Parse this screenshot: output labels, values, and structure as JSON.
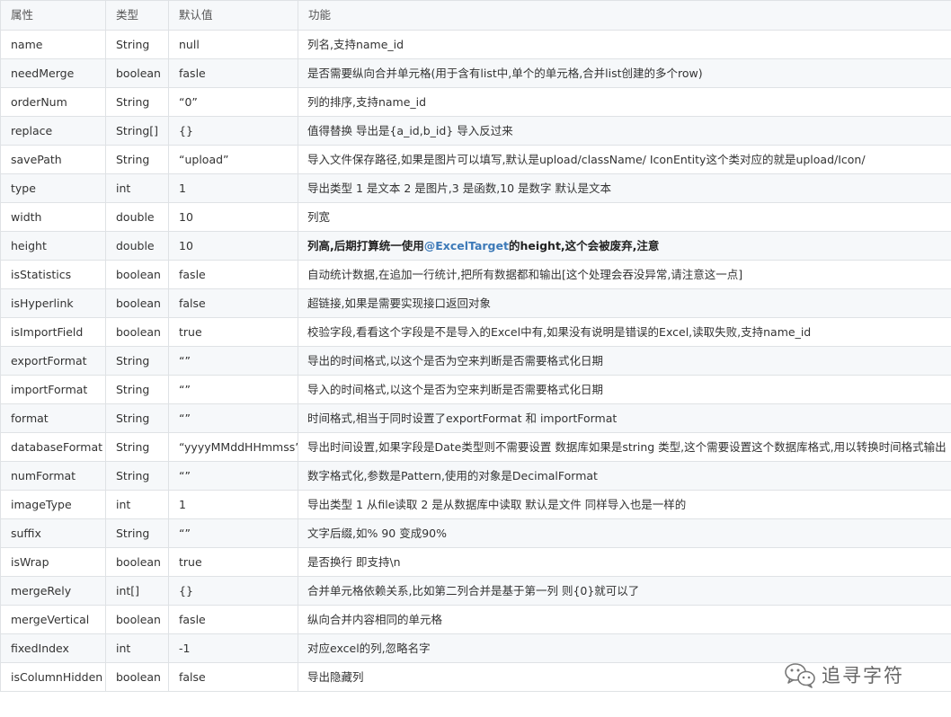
{
  "table": {
    "headers": [
      "属性",
      "类型",
      "默认值",
      "功能"
    ],
    "rows": [
      {
        "name": "name",
        "type": "String",
        "default": "null",
        "desc": "列名,支持name_id"
      },
      {
        "name": "needMerge",
        "type": "boolean",
        "default": "fasle",
        "desc": "是否需要纵向合并单元格(用于含有list中,单个的单元格,合并list创建的多个row)"
      },
      {
        "name": "orderNum",
        "type": "String",
        "default": "“0”",
        "desc": "列的排序,支持name_id"
      },
      {
        "name": "replace",
        "type": "String[]",
        "default": "{}",
        "desc": "值得替换 导出是{a_id,b_id} 导入反过来"
      },
      {
        "name": "savePath",
        "type": "String",
        "default": "“upload”",
        "desc": "导入文件保存路径,如果是图片可以填写,默认是upload/className/ IconEntity这个类对应的就是upload/Icon/"
      },
      {
        "name": "type",
        "type": "int",
        "default": "1",
        "desc": "导出类型 1 是文本 2 是图片,3 是函数,10 是数字 默认是文本"
      },
      {
        "name": "width",
        "type": "double",
        "default": "10",
        "desc": "列宽"
      },
      {
        "name": "height",
        "type": "double",
        "default": "10",
        "desc_pre": "列高,后期打算统一使用",
        "desc_link": "@ExcelTarget",
        "desc_post": "的height,这个会被废弃,注意"
      },
      {
        "name": "isStatistics",
        "type": "boolean",
        "default": "fasle",
        "desc": "自动统计数据,在追加一行统计,把所有数据都和输出[这个处理会吞没异常,请注意这一点]"
      },
      {
        "name": "isHyperlink",
        "type": "boolean",
        "default": "false",
        "desc": "超链接,如果是需要实现接口返回对象"
      },
      {
        "name": "isImportField",
        "type": "boolean",
        "default": "true",
        "desc": "校验字段,看看这个字段是不是导入的Excel中有,如果没有说明是错误的Excel,读取失败,支持name_id"
      },
      {
        "name": "exportFormat",
        "type": "String",
        "default": "“”",
        "desc": "导出的时间格式,以这个是否为空来判断是否需要格式化日期"
      },
      {
        "name": "importFormat",
        "type": "String",
        "default": "“”",
        "desc": "导入的时间格式,以这个是否为空来判断是否需要格式化日期"
      },
      {
        "name": "format",
        "type": "String",
        "default": "“”",
        "desc": "时间格式,相当于同时设置了exportFormat 和 importFormat"
      },
      {
        "name": "databaseFormat",
        "type": "String",
        "default": "“yyyyMMddHHmmss”",
        "desc": "导出时间设置,如果字段是Date类型则不需要设置 数据库如果是string 类型,这个需要设置这个数据库格式,用以转换时间格式输出"
      },
      {
        "name": "numFormat",
        "type": "String",
        "default": "“”",
        "desc": "数字格式化,参数是Pattern,使用的对象是DecimalFormat"
      },
      {
        "name": "imageType",
        "type": "int",
        "default": "1",
        "desc": "导出类型 1 从file读取 2 是从数据库中读取 默认是文件 同样导入也是一样的"
      },
      {
        "name": "suffix",
        "type": "String",
        "default": "“”",
        "desc": "文字后缀,如% 90 变成90%"
      },
      {
        "name": "isWrap",
        "type": "boolean",
        "default": "true",
        "desc": "是否换行 即支持\\n"
      },
      {
        "name": "mergeRely",
        "type": "int[]",
        "default": "{}",
        "desc": "合并单元格依赖关系,比如第二列合并是基于第一列 则{0}就可以了"
      },
      {
        "name": "mergeVertical",
        "type": "boolean",
        "default": "fasle",
        "desc": "纵向合并内容相同的单元格"
      },
      {
        "name": "fixedIndex",
        "type": "int",
        "default": "-1",
        "desc": "对应excel的列,忽略名字"
      },
      {
        "name": "isColumnHidden",
        "type": "boolean",
        "default": "false",
        "desc": "导出隐藏列"
      }
    ]
  },
  "watermark": {
    "text": "追寻字符",
    "icon": "wechat-icon"
  }
}
